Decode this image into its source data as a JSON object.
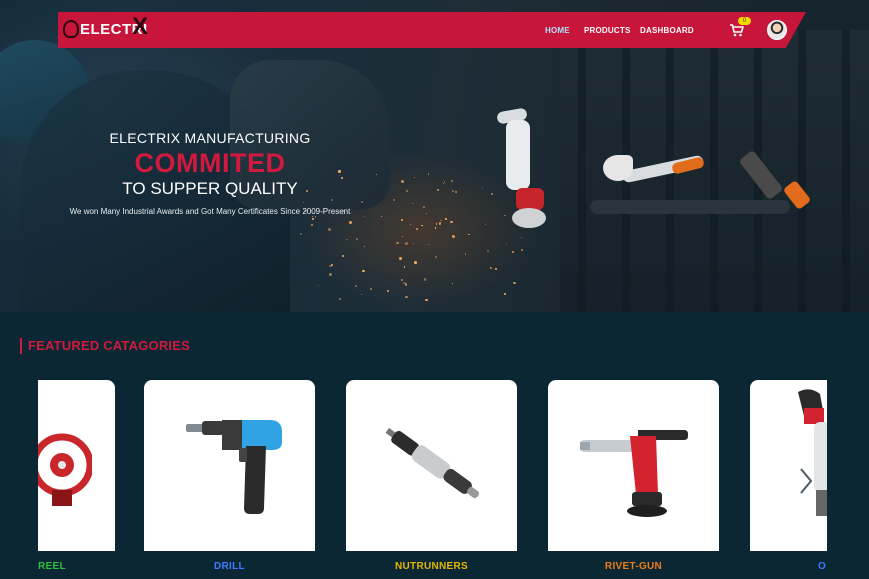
{
  "brand": {
    "logo_text": "ELECTRI",
    "logo_mark": "X",
    "nav_color": "#c7163a",
    "accent": "#d11a3d"
  },
  "nav": {
    "links": [
      {
        "label": "HOME",
        "active": true
      },
      {
        "label": "PRODUCTS",
        "active": false
      },
      {
        "label": "DASHBOARD",
        "active": false
      }
    ],
    "cart_icon": "cart-icon",
    "cart_count": "0",
    "avatar_icon": "user-avatar"
  },
  "hero": {
    "subtitle": "ELECTRIX MANUFACTURING",
    "title": "COMMITED",
    "tagline": "TO SUPPER QUALITY",
    "caption": "We won Many Industrial Awards and Got Many Certificates Since 2009-Present"
  },
  "featured": {
    "heading": "FEATURED CATAGORIES",
    "categories": [
      {
        "label": "REEL",
        "color": "#2fbf3f"
      },
      {
        "label": "DRILL",
        "color": "#3d7bff"
      },
      {
        "label": "NUTRUNNERS",
        "color": "#e2b800"
      },
      {
        "label": "RIVET-GUN",
        "color": "#f07a16"
      },
      {
        "label": "O",
        "color": "#3d7bff"
      }
    ],
    "next_icon": "chevron-right-icon"
  }
}
